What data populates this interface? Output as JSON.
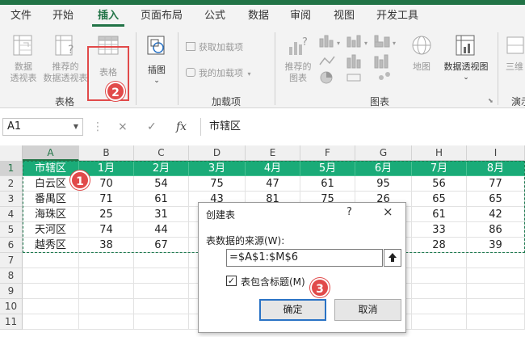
{
  "tabs": [
    "文件",
    "开始",
    "插入",
    "页面布局",
    "公式",
    "数据",
    "审阅",
    "视图",
    "开发工具"
  ],
  "active_tab": "插入",
  "ribbon": {
    "pivot_line1": "数据",
    "pivot_line2": "透视表",
    "rec_pivot_line1": "推荐的",
    "rec_pivot_line2": "数据透视表",
    "table_label": "表格",
    "tables_group": "表格",
    "illustrations_label": "插图",
    "get_addins": "获取加载项",
    "my_addins": "我的加载项",
    "addins_group": "加载项",
    "rec_charts_line1": "推荐的",
    "rec_charts_line2": "图表",
    "maps_label": "地图",
    "pivot_chart_label": "数据透视图",
    "charts_group": "图表",
    "three_d_label": "三维",
    "tours_group": "演示"
  },
  "formula_bar": {
    "name_box": "A1",
    "cancel_glyph": "×",
    "enter_glyph": "✓",
    "fx_glyph": "fx",
    "formula": "市辖区"
  },
  "grid": {
    "columns": [
      "A",
      "B",
      "C",
      "D",
      "E",
      "F",
      "G",
      "H",
      "I"
    ],
    "rows": [
      "1",
      "2",
      "3",
      "4",
      "5",
      "6",
      "7",
      "8",
      "9",
      "10",
      "11"
    ],
    "header_row": [
      "市辖区",
      "1月",
      "2月",
      "3月",
      "4月",
      "5月",
      "6月",
      "7月",
      "8月"
    ],
    "data": [
      [
        "白云区",
        "70",
        "54",
        "75",
        "47",
        "61",
        "95",
        "56",
        "77"
      ],
      [
        "番禺区",
        "71",
        "61",
        "43",
        "81",
        "75",
        "26",
        "65",
        "65"
      ],
      [
        "海珠区",
        "25",
        "31",
        "",
        "",
        "",
        "",
        "61",
        "42"
      ],
      [
        "天河区",
        "74",
        "44",
        "",
        "",
        "",
        "",
        "33",
        "86"
      ],
      [
        "越秀区",
        "38",
        "67",
        "",
        "",
        "",
        "",
        "28",
        "39"
      ]
    ]
  },
  "dialog": {
    "title": "创建表",
    "help": "?",
    "close": "×",
    "source_label": "表数据的来源(W):",
    "range_value": "=$A$1:$M$6",
    "checkbox_label": "表包含标题(M)",
    "checkbox_checked": "✓",
    "ok": "确定",
    "cancel": "取消"
  },
  "callouts": [
    "1",
    "2",
    "3"
  ],
  "colors": {
    "accent": "#217346",
    "header_fill": "#1aab78",
    "callout": "#e14a4a"
  }
}
